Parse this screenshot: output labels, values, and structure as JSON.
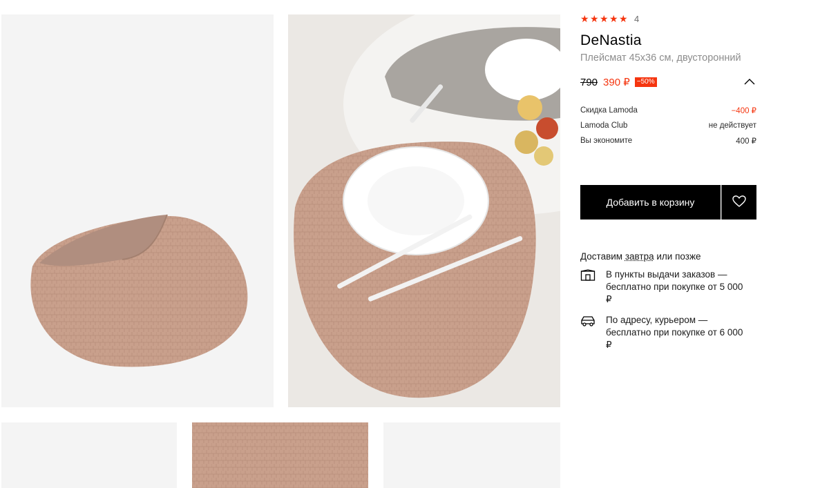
{
  "gallery": {
    "main_alt": "Плейсмат",
    "images": [
      "product-photo",
      "table-setting-photo",
      "thumbnail-1",
      "thumbnail-2-texture",
      "thumbnail-3"
    ]
  },
  "product": {
    "rating": 5,
    "review_count": "4",
    "brand": "DeNastia",
    "name": "Плейсмат 45х36 см, двусторонний"
  },
  "price": {
    "old": "790",
    "new": "390 ₽",
    "discount": "−50%",
    "breakdown": [
      {
        "label": "Скидка Lamoda",
        "value": "−400 ₽"
      },
      {
        "label": "Lamoda Club",
        "value": "не действует"
      },
      {
        "label": "Вы экономите",
        "value": "400 ₽"
      }
    ]
  },
  "actions": {
    "add_to_cart": "Добавить в корзину"
  },
  "delivery": {
    "title_prefix": "Доставим ",
    "title_link": "завтра",
    "title_suffix": " или позже",
    "options": [
      {
        "icon": "pickup-point-icon",
        "text": "В пункты выдачи заказов — бесплатно при покупке от 5 000 ₽"
      },
      {
        "icon": "courier-car-icon",
        "text": "По адресу, курьером — бесплатно при покупке от 6 000 ₽"
      }
    ]
  },
  "colors": {
    "accent": "#f5350f",
    "button": "#000000",
    "placemat": "#c9a594"
  }
}
